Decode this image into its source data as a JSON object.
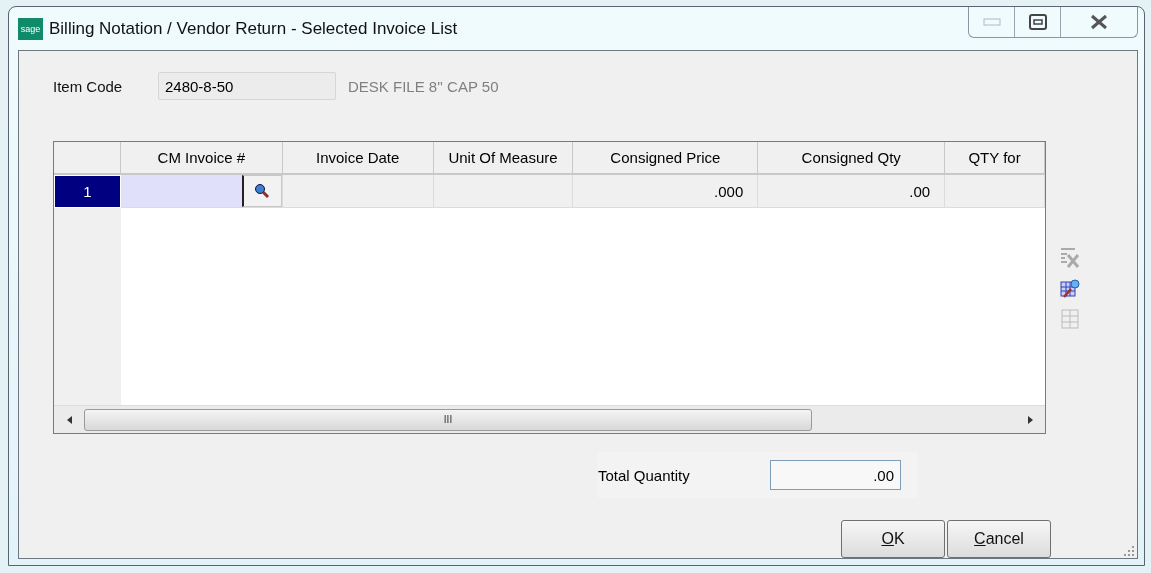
{
  "window": {
    "title": "Billing Notation / Vendor Return - Selected Invoice List",
    "logo": "sage"
  },
  "item": {
    "label": "Item Code",
    "value": "2480-8-50",
    "description": "DESK FILE 8'' CAP 50"
  },
  "table": {
    "columns": [
      "CM Invoice #",
      "Invoice Date",
      "Unit Of Measure",
      "Consigned Price",
      "Consigned Qty",
      "QTY for"
    ],
    "rows": [
      {
        "number": "1",
        "selected": true,
        "cells": [
          "",
          "",
          "",
          ".000",
          ".00",
          ""
        ]
      }
    ]
  },
  "scrollbar_grip": "III",
  "total": {
    "label": "Total Quantity",
    "value": ".00"
  },
  "buttons": [
    {
      "mnemonic": "O",
      "rest": "K"
    },
    {
      "mnemonic": "C",
      "rest": "ancel"
    }
  ]
}
